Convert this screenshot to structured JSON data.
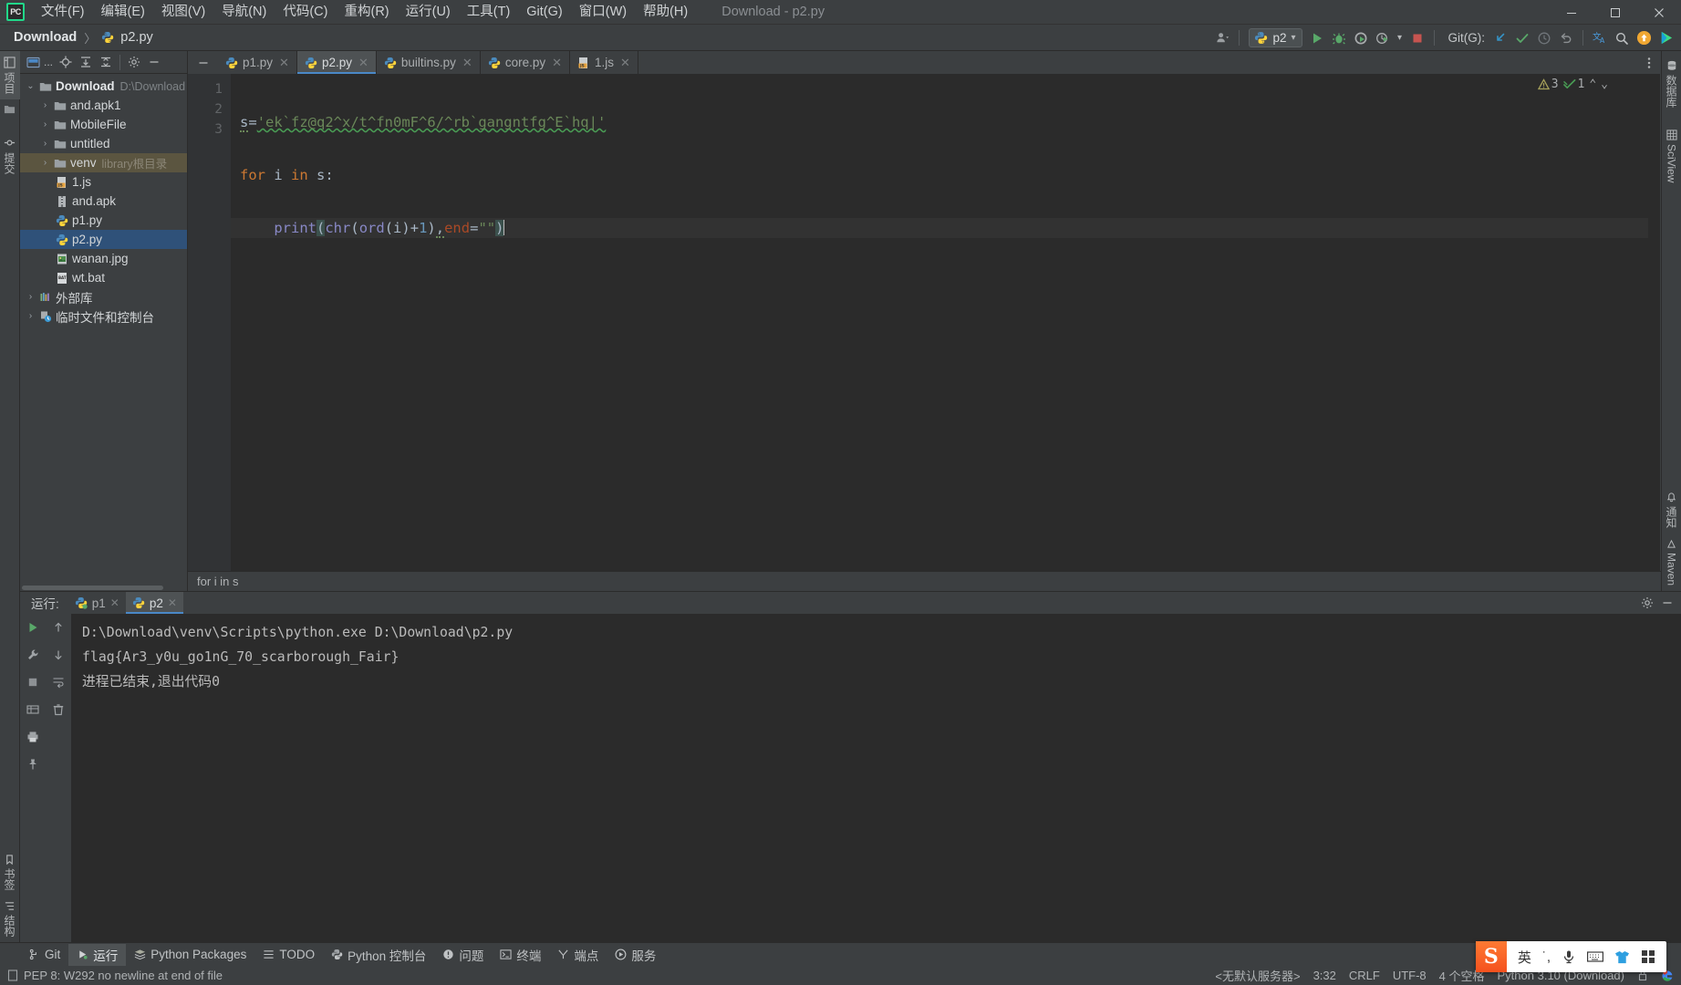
{
  "window": {
    "app_icon": "pycharm-logo-icon",
    "title": "Download - p2.py",
    "controls": {
      "minimize": "—",
      "maximize": "❐",
      "close": "✕"
    }
  },
  "menubar": {
    "items": [
      {
        "label": "文件(F)",
        "name": "menu-file"
      },
      {
        "label": "编辑(E)",
        "name": "menu-edit"
      },
      {
        "label": "视图(V)",
        "name": "menu-view"
      },
      {
        "label": "导航(N)",
        "name": "menu-navigate"
      },
      {
        "label": "代码(C)",
        "name": "menu-code"
      },
      {
        "label": "重构(R)",
        "name": "menu-refactor"
      },
      {
        "label": "运行(U)",
        "name": "menu-run"
      },
      {
        "label": "工具(T)",
        "name": "menu-tools"
      },
      {
        "label": "Git(G)",
        "name": "menu-git"
      },
      {
        "label": "窗口(W)",
        "name": "menu-window"
      },
      {
        "label": "帮助(H)",
        "name": "menu-help"
      }
    ]
  },
  "navbar": {
    "breadcrumbs": [
      {
        "label": "Download",
        "icon": ""
      },
      {
        "label": "p2.py",
        "icon": "python-file-icon"
      }
    ],
    "separator": "〉",
    "run_config": {
      "name": "p2",
      "icon": "python-icon",
      "chevron": "▾"
    },
    "git_label": "Git(G):",
    "buttons": [
      {
        "name": "user-settings-button",
        "icon": "person-icon"
      },
      {
        "name": "run-button",
        "icon": "play-icon"
      },
      {
        "name": "debug-button",
        "icon": "bug-icon"
      },
      {
        "name": "run-coverage-button",
        "icon": "coverage-icon"
      },
      {
        "name": "profile-button",
        "icon": "profiler-icon"
      },
      {
        "name": "stop-button",
        "icon": "stop-icon"
      },
      {
        "name": "git-update-button",
        "icon": "update-arrow-icon"
      },
      {
        "name": "git-commit-button",
        "icon": "check-icon"
      },
      {
        "name": "git-history-button",
        "icon": "clock-icon"
      },
      {
        "name": "git-rollback-button",
        "icon": "undo-icon"
      },
      {
        "name": "translate-button",
        "icon": "translate-icon"
      },
      {
        "name": "search-everywhere-button",
        "icon": "search-icon"
      },
      {
        "name": "updates-button",
        "icon": "update-badge-icon"
      },
      {
        "name": "ide-feature-button",
        "icon": "play-colored-icon"
      }
    ]
  },
  "left_strip": {
    "top": [
      {
        "label": "项目",
        "name": "tool-window-project",
        "icon": "project-icon",
        "active": true
      },
      {
        "label": "",
        "name": "tool-window-structure",
        "icon": "folder-icon",
        "active": false
      },
      {
        "label": "提交",
        "name": "tool-window-commit",
        "icon": "commit-icon",
        "active": false
      }
    ],
    "bottom": [
      {
        "label": "书签",
        "name": "tool-window-bookmarks",
        "icon": "bookmark-icon"
      },
      {
        "label": "结构",
        "name": "tool-window-structure2",
        "icon": "structure-icon"
      }
    ]
  },
  "right_strip": {
    "items": [
      {
        "label": "数据库",
        "name": "tool-window-database",
        "icon": "database-icon"
      },
      {
        "label": "SciView",
        "name": "tool-window-sciview",
        "icon": "grid-icon"
      },
      {
        "label": "通知",
        "name": "tool-window-notifications",
        "icon": "bell-icon"
      },
      {
        "label": "Maven",
        "name": "tool-window-maven",
        "icon": "maven-icon"
      }
    ]
  },
  "project_panel": {
    "toolbar": [
      {
        "name": "project-view-selector",
        "icon": "project-view-icon",
        "label": "..."
      },
      {
        "name": "locate-file-button",
        "icon": "crosshair-icon"
      },
      {
        "name": "expand-all-button",
        "icon": "expand-all-icon"
      },
      {
        "name": "collapse-all-button",
        "icon": "collapse-all-icon"
      },
      {
        "name": "settings-button",
        "icon": "gear-icon"
      },
      {
        "name": "hide-button",
        "icon": "minus-icon"
      }
    ],
    "tree": [
      {
        "label": "Download",
        "sub": "D:\\Download",
        "icon": "folder-icon",
        "twist": "⌄",
        "depth": 0,
        "bold": true,
        "state": ""
      },
      {
        "label": "and.apk1",
        "sub": "",
        "icon": "folder-icon",
        "twist": "›",
        "depth": 1,
        "bold": false,
        "state": ""
      },
      {
        "label": "MobileFile",
        "sub": "",
        "icon": "folder-icon",
        "twist": "›",
        "depth": 1,
        "bold": false,
        "state": ""
      },
      {
        "label": "untitled",
        "sub": "",
        "icon": "folder-icon",
        "twist": "›",
        "depth": 1,
        "bold": false,
        "state": ""
      },
      {
        "label": "venv",
        "sub": "library根目录",
        "icon": "folder-icon",
        "twist": "›",
        "depth": 1,
        "bold": false,
        "state": "highlight"
      },
      {
        "label": "1.js",
        "sub": "",
        "icon": "js-file-icon",
        "twist": "",
        "depth": 2,
        "bold": false,
        "state": ""
      },
      {
        "label": "and.apk",
        "sub": "",
        "icon": "archive-file-icon",
        "twist": "",
        "depth": 2,
        "bold": false,
        "state": ""
      },
      {
        "label": "p1.py",
        "sub": "",
        "icon": "python-file-icon",
        "twist": "",
        "depth": 2,
        "bold": false,
        "state": ""
      },
      {
        "label": "p2.py",
        "sub": "",
        "icon": "python-file-icon",
        "twist": "",
        "depth": 2,
        "bold": false,
        "state": "selected"
      },
      {
        "label": "wanan.jpg",
        "sub": "",
        "icon": "image-file-icon",
        "twist": "",
        "depth": 2,
        "bold": false,
        "state": ""
      },
      {
        "label": "wt.bat",
        "sub": "",
        "icon": "bat-file-icon",
        "twist": "",
        "depth": 2,
        "bold": false,
        "state": ""
      },
      {
        "label": "外部库",
        "sub": "",
        "icon": "library-icon",
        "twist": "›",
        "depth": 0,
        "bold": false,
        "state": ""
      },
      {
        "label": "临时文件和控制台",
        "sub": "",
        "icon": "scratches-icon",
        "twist": "›",
        "depth": 0,
        "bold": false,
        "state": ""
      }
    ]
  },
  "editor": {
    "tabs": [
      {
        "label": "p1.py",
        "icon": "python-file-icon",
        "active": false,
        "close": "✕"
      },
      {
        "label": "p2.py",
        "icon": "python-file-icon",
        "active": true,
        "close": "✕"
      },
      {
        "label": "builtins.py",
        "icon": "python-file-icon",
        "active": false,
        "close": "✕"
      },
      {
        "label": "core.py",
        "icon": "python-file-icon",
        "active": false,
        "close": "✕"
      },
      {
        "label": "1.js",
        "icon": "js-file-icon",
        "active": false,
        "close": "✕"
      }
    ],
    "line_numbers": [
      "1",
      "2",
      "3"
    ],
    "code_lines": [
      {
        "n": "1",
        "text": "s='ek`fz@q2^x/t^fn0mF^6/^rb`gangntfg^E`hq|'"
      },
      {
        "n": "2",
        "text": "for i in s:"
      },
      {
        "n": "3",
        "text": "    print(chr(ord(i)+1),end=\"\")"
      }
    ],
    "code_tokens": {
      "line1": {
        "var": "s",
        "op": "=",
        "str": "'ek`fz@q2^x/t^fn0mF^6/^rb`gangntfg^E`hq|'"
      },
      "line2": {
        "kw_for": "for",
        "var_i": "i",
        "kw_in": "in",
        "var_s": "s",
        "colon": ":"
      },
      "line3": {
        "fn": "print",
        "open": "(",
        "chr": "chr",
        "open2": "(",
        "ord": "ord",
        "open3": "(",
        "i": "i",
        "close3": ")",
        "plus": "+",
        "one": "1",
        "close2": ")",
        "comma": ",",
        "end": "end",
        "eq": "=",
        "quotes": "\"\"",
        "close": ")"
      }
    },
    "inspections": {
      "warnings": "3",
      "warning_icon": "warning-triangle-icon",
      "oks": "1",
      "ok_icon": "inspection-check-icon",
      "up": "⌃",
      "down": "⌄"
    },
    "more_menu_icon": "vertical-dots-icon",
    "breadcrumb_status": "for i in s"
  },
  "run_panel": {
    "title": "运行:",
    "tabs": [
      {
        "label": "p1",
        "icon": "python-run-icon",
        "active": false,
        "close": "✕"
      },
      {
        "label": "p2",
        "icon": "python-run-icon",
        "active": true,
        "close": "✕"
      }
    ],
    "header_buttons": [
      {
        "name": "run-settings-button",
        "icon": "gear-icon"
      },
      {
        "name": "hide-run-panel-button",
        "icon": "minus-icon"
      }
    ],
    "gutter_buttons": [
      {
        "name": "rerun-button",
        "icon": "play-icon"
      },
      {
        "name": "edit-configurations-button",
        "icon": "wrench-icon"
      },
      {
        "name": "stop-process-button",
        "icon": "stop-icon"
      },
      {
        "name": "print-button",
        "icon": "printer-icon"
      },
      {
        "name": "pin-tab-button",
        "icon": "pin-icon"
      },
      {
        "name": "scroll-up-button",
        "icon": "arrow-up-icon"
      },
      {
        "name": "scroll-down-button",
        "icon": "arrow-down-icon"
      },
      {
        "name": "soft-wrap-button",
        "icon": "wrap-icon"
      },
      {
        "name": "clear-all-button",
        "icon": "trash-icon"
      },
      {
        "name": "table-view-button",
        "icon": "table-icon"
      }
    ],
    "console_lines": [
      "D:\\Download\\venv\\Scripts\\python.exe D:\\Download\\p2.py",
      "flag{Ar3_y0u_go1nG_70_scarborough_Fair}",
      "进程已结束,退出代码0"
    ]
  },
  "bottom_tools": [
    {
      "label": "Git",
      "icon": "git-branch-icon",
      "name": "bottom-tool-git",
      "active": false
    },
    {
      "label": "运行",
      "icon": "play-icon",
      "name": "bottom-tool-run",
      "active": true
    },
    {
      "label": "Python Packages",
      "icon": "packages-icon",
      "name": "bottom-tool-python-packages",
      "active": false
    },
    {
      "label": "TODO",
      "icon": "todo-icon",
      "name": "bottom-tool-todo",
      "active": false
    },
    {
      "label": "Python 控制台",
      "icon": "python-console-icon",
      "name": "bottom-tool-python-console",
      "active": false
    },
    {
      "label": "问题",
      "icon": "problems-icon",
      "name": "bottom-tool-problems",
      "active": false
    },
    {
      "label": "终端",
      "icon": "terminal-icon",
      "name": "bottom-tool-terminal",
      "active": false
    },
    {
      "label": "端点",
      "icon": "endpoints-icon",
      "name": "bottom-tool-endpoints",
      "active": false
    },
    {
      "label": "服务",
      "icon": "services-icon",
      "name": "bottom-tool-services",
      "active": false
    }
  ],
  "statusbar": {
    "message": "PEP 8: W292 no newline at end of file",
    "message_icon": "inspection-doc-icon",
    "right": [
      {
        "label": "<无默认服务器>",
        "name": "status-server"
      },
      {
        "label": "3:32",
        "name": "status-caret-position"
      },
      {
        "label": "CRLF",
        "name": "status-line-separator"
      },
      {
        "label": "UTF-8",
        "name": "status-encoding"
      },
      {
        "label": "4 个空格",
        "name": "status-indent"
      },
      {
        "label": "Python 3.10 (Download)",
        "name": "status-interpreter"
      }
    ],
    "lock_icon": "lock-icon",
    "google_icon": "google-icon"
  },
  "ime": {
    "logo": "S",
    "items": [
      {
        "label": "英",
        "name": "ime-language-toggle"
      },
      {
        "label": "˙,",
        "name": "ime-punctuation-toggle"
      },
      {
        "label": "🎤",
        "name": "ime-voice-input"
      },
      {
        "label": "⌨",
        "name": "ime-keyboard"
      },
      {
        "label": "👕",
        "name": "ime-skin"
      },
      {
        "label": "▦",
        "name": "ime-toolbox"
      }
    ]
  },
  "colors": {
    "accent_blue": "#4a88c7",
    "selection": "#2f5179",
    "string_green": "#6a8759",
    "keyword_orange": "#cc7832",
    "number_blue": "#6897bb",
    "bg_panel": "#3c3f41",
    "bg_editor": "#2b2b2b"
  }
}
